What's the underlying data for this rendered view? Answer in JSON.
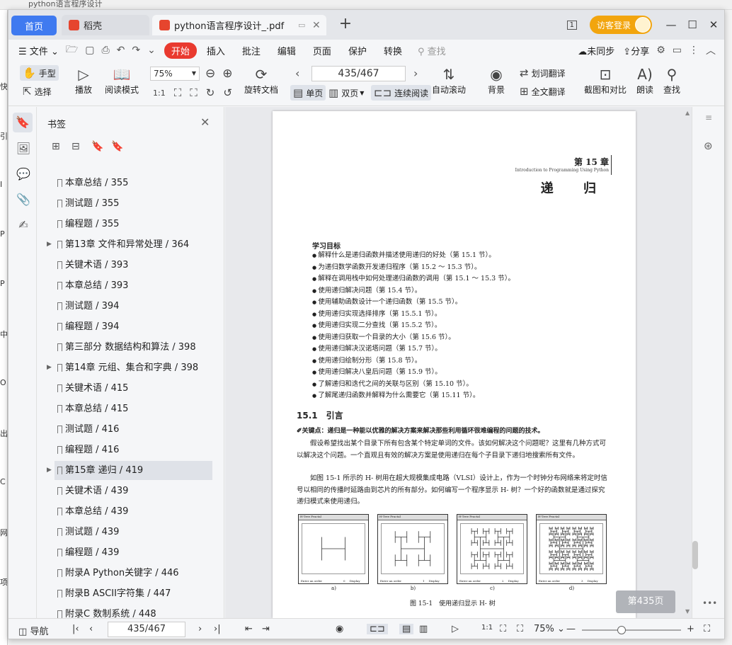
{
  "background": {
    "strip_text": "python语言程序设计",
    "left_chars": [
      "快",
      "引",
      "Ⅰ",
      "P",
      "P",
      "中",
      "O",
      "出",
      "C",
      "网",
      "项"
    ]
  },
  "tabs": {
    "home": "首页",
    "dk": "稻壳",
    "pdf": "python语言程序设计_.pdf",
    "new_tab": "+"
  },
  "titlebar": {
    "visitor_login": "访客登录",
    "page_count_icon": "1"
  },
  "menu": {
    "file": "文件",
    "start": "开始",
    "insert": "插入",
    "annotate": "批注",
    "edit": "编辑",
    "page": "页面",
    "protect": "保护",
    "convert": "转换",
    "search": "查找",
    "unsync": "未同步",
    "share": "分享"
  },
  "toolbar": {
    "hand": "手型",
    "select": "选择",
    "play": "播放",
    "read_mode": "阅读模式",
    "zoom": "75%",
    "rotate": "旋转文档",
    "page_value": "435/467",
    "single": "单页",
    "double": "双页",
    "continuous": "连续阅读",
    "auto_scroll": "自动滚动",
    "background": "背景",
    "word_translate": "划词翻译",
    "full_translate": "全文翻译",
    "screenshot_compare": "截图和对比",
    "read_aloud": "朗读",
    "find": "查找"
  },
  "bookmarks": {
    "title": "书签",
    "items": [
      {
        "label": "本章总结 / 355",
        "expandable": false,
        "selected": false
      },
      {
        "label": "测试题 / 355",
        "expandable": false,
        "selected": false
      },
      {
        "label": "编程题 / 355",
        "expandable": false,
        "selected": false
      },
      {
        "label": "第13章 文件和异常处理 / 364",
        "expandable": true,
        "selected": false
      },
      {
        "label": "关键术语 / 393",
        "expandable": false,
        "selected": false
      },
      {
        "label": "本章总结 / 393",
        "expandable": false,
        "selected": false
      },
      {
        "label": "测试题 / 394",
        "expandable": false,
        "selected": false
      },
      {
        "label": "编程题 / 394",
        "expandable": false,
        "selected": false
      },
      {
        "label": "第三部分 数据结构和算法 / 398",
        "expandable": false,
        "selected": false
      },
      {
        "label": "第14章 元组、集合和字典 / 398",
        "expandable": true,
        "selected": false
      },
      {
        "label": "关键术语 / 415",
        "expandable": false,
        "selected": false
      },
      {
        "label": "本章总结 / 415",
        "expandable": false,
        "selected": false
      },
      {
        "label": "测试题 / 416",
        "expandable": false,
        "selected": false
      },
      {
        "label": "编程题 / 416",
        "expandable": false,
        "selected": false
      },
      {
        "label": "第15章 递归 / 419",
        "expandable": true,
        "selected": true
      },
      {
        "label": "关键术语 / 439",
        "expandable": false,
        "selected": false
      },
      {
        "label": "本章总结 / 439",
        "expandable": false,
        "selected": false
      },
      {
        "label": "测试题 / 439",
        "expandable": false,
        "selected": false
      },
      {
        "label": "编程题 / 439",
        "expandable": false,
        "selected": false
      },
      {
        "label": "附录A Python关键字 / 446",
        "expandable": false,
        "selected": false
      },
      {
        "label": "附录B ASCII字符集 / 447",
        "expandable": false,
        "selected": false
      },
      {
        "label": "附录C 数制系统 / 448",
        "expandable": false,
        "selected": false
      }
    ]
  },
  "document": {
    "chapter_label": "第 15 章",
    "chapter_en": "Introduction to Programming Using Python",
    "chapter_title": "递 归",
    "objectives_heading": "学习目标",
    "objectives": [
      "解释什么是递归函数并描述使用递归的好处（第 15.1 节）。",
      "为递归数学函数开发递归程序（第 15.2 ～ 15.3 节）。",
      "解释在调用栈中如何处理递归函数的调用（第 15.1 ～ 15.3 节）。",
      "使用递归解决问题（第 15.4 节）。",
      "使用辅助函数设计一个递归函数（第 15.5 节）。",
      "使用递归实现选择排序（第 15.5.1 节）。",
      "使用递归实现二分查找（第 15.5.2 节）。",
      "使用递归获取一个目录的大小（第 15.6 节）。",
      "使用递归解决汉诺塔问题（第 15.7 节）。",
      "使用递归绘制分形（第 15.8 节）。",
      "使用递归解决八皇后问题（第 15.9 节）。",
      "了解递归和迭代之间的关联与区别（第 15.10 节）。",
      "了解尾递归函数并解释为什么需要它（第 15.11 节）。"
    ],
    "section_title": "15.1　引言",
    "key_point": "关键点：递归是一种能以优雅的解决方案来解决那些利用循环很难编程的问题的技术。",
    "para1": "假设希望找出某个目录下所有包含某个特定单词的文件。该如何解决这个问题呢？这里有几种方式可以解决这个问题。一个直观且有效的解决方案是使用递归在每个子目录下递归地搜索所有文件。",
    "para2": "如图 15-1 所示的 H- 树用在超大规模集成电路（VLSI）设计上，作为一个时钟分布网络来将定时信号以相同的传播时延路由到芯片的所有部分。如何编写一个程序显示 H- 树？一个好的函数就是通过探究递归模式来使用递归。",
    "figure_labels": [
      "a)",
      "b)",
      "c)",
      "d)"
    ],
    "figure_window_title": "H-Tree Fractal",
    "figure_order_text": "Enter an order",
    "figure_order_values": [
      "0",
      "1",
      "2",
      "3"
    ],
    "figure_display": "Display",
    "figure_caption": "图 15-1　使用递归显示 H- 树",
    "page_pill": "第435页"
  },
  "statusbar": {
    "nav": "导航",
    "page_value": "435/467",
    "zoom": "75%"
  }
}
